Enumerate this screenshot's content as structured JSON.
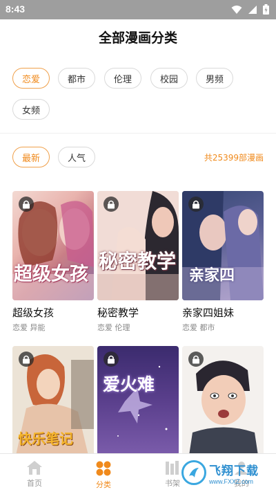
{
  "status_bar": {
    "time": "8:43"
  },
  "page_title": "全部漫画分类",
  "categories": [
    {
      "label": "恋爱",
      "active": true
    },
    {
      "label": "都市",
      "active": false
    },
    {
      "label": "伦理",
      "active": false
    },
    {
      "label": "校园",
      "active": false
    },
    {
      "label": "男频",
      "active": false
    },
    {
      "label": "女频",
      "active": false
    }
  ],
  "sorts": [
    {
      "label": "最新",
      "active": true
    },
    {
      "label": "人气",
      "active": false
    }
  ],
  "total_count": "共25399部漫画",
  "comics": [
    {
      "title": "超级女孩",
      "tags": "恋爱 异能",
      "locked": true,
      "cover_text": "超级女孩"
    },
    {
      "title": "秘密教学",
      "tags": "恋爱 伦理",
      "locked": true,
      "cover_text": "秘密教学"
    },
    {
      "title": "亲家四姐妹",
      "tags": "恋爱 都市",
      "locked": true,
      "cover_text": "亲家四"
    },
    {
      "title": "",
      "tags": "",
      "locked": true,
      "cover_text": "快乐笔记"
    },
    {
      "title": "",
      "tags": "",
      "locked": true,
      "cover_text": "爱火难"
    },
    {
      "title": "",
      "tags": "",
      "locked": true,
      "cover_text": ""
    }
  ],
  "bottom_nav": [
    {
      "label": "首页",
      "icon": "home-icon",
      "active": false
    },
    {
      "label": "分类",
      "icon": "category-icon",
      "active": true
    },
    {
      "label": "书架",
      "icon": "bookshelf-icon",
      "active": false
    },
    {
      "label": "我的",
      "icon": "profile-icon",
      "active": false
    }
  ],
  "watermark": {
    "title": "飞翔下载",
    "url": "www.FXXZ.com"
  },
  "colors": {
    "accent": "#f08a1c",
    "status_bar": "#9e9e9e"
  }
}
